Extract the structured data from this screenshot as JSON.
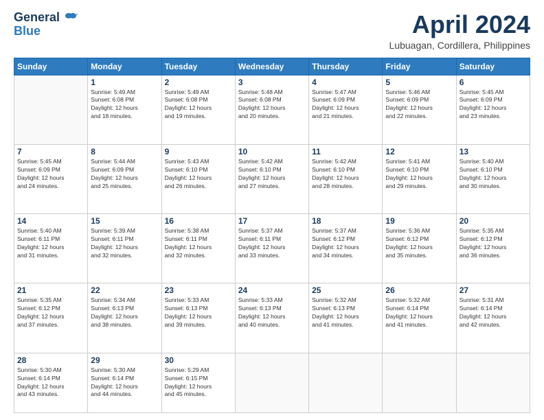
{
  "header": {
    "logo_line1": "General",
    "logo_line2": "Blue",
    "month": "April 2024",
    "location": "Lubuagan, Cordillera, Philippines"
  },
  "weekdays": [
    "Sunday",
    "Monday",
    "Tuesday",
    "Wednesday",
    "Thursday",
    "Friday",
    "Saturday"
  ],
  "weeks": [
    [
      {
        "day": "",
        "info": ""
      },
      {
        "day": "1",
        "info": "Sunrise: 5:49 AM\nSunset: 6:08 PM\nDaylight: 12 hours\nand 18 minutes."
      },
      {
        "day": "2",
        "info": "Sunrise: 5:49 AM\nSunset: 6:08 PM\nDaylight: 12 hours\nand 19 minutes."
      },
      {
        "day": "3",
        "info": "Sunrise: 5:48 AM\nSunset: 6:08 PM\nDaylight: 12 hours\nand 20 minutes."
      },
      {
        "day": "4",
        "info": "Sunrise: 5:47 AM\nSunset: 6:09 PM\nDaylight: 12 hours\nand 21 minutes."
      },
      {
        "day": "5",
        "info": "Sunrise: 5:46 AM\nSunset: 6:09 PM\nDaylight: 12 hours\nand 22 minutes."
      },
      {
        "day": "6",
        "info": "Sunrise: 5:45 AM\nSunset: 6:09 PM\nDaylight: 12 hours\nand 23 minutes."
      }
    ],
    [
      {
        "day": "7",
        "info": "Sunrise: 5:45 AM\nSunset: 6:09 PM\nDaylight: 12 hours\nand 24 minutes."
      },
      {
        "day": "8",
        "info": "Sunrise: 5:44 AM\nSunset: 6:09 PM\nDaylight: 12 hours\nand 25 minutes."
      },
      {
        "day": "9",
        "info": "Sunrise: 5:43 AM\nSunset: 6:10 PM\nDaylight: 12 hours\nand 26 minutes."
      },
      {
        "day": "10",
        "info": "Sunrise: 5:42 AM\nSunset: 6:10 PM\nDaylight: 12 hours\nand 27 minutes."
      },
      {
        "day": "11",
        "info": "Sunrise: 5:42 AM\nSunset: 6:10 PM\nDaylight: 12 hours\nand 28 minutes."
      },
      {
        "day": "12",
        "info": "Sunrise: 5:41 AM\nSunset: 6:10 PM\nDaylight: 12 hours\nand 29 minutes."
      },
      {
        "day": "13",
        "info": "Sunrise: 5:40 AM\nSunset: 6:10 PM\nDaylight: 12 hours\nand 30 minutes."
      }
    ],
    [
      {
        "day": "14",
        "info": "Sunrise: 5:40 AM\nSunset: 6:11 PM\nDaylight: 12 hours\nand 31 minutes."
      },
      {
        "day": "15",
        "info": "Sunrise: 5:39 AM\nSunset: 6:11 PM\nDaylight: 12 hours\nand 32 minutes."
      },
      {
        "day": "16",
        "info": "Sunrise: 5:38 AM\nSunset: 6:11 PM\nDaylight: 12 hours\nand 32 minutes."
      },
      {
        "day": "17",
        "info": "Sunrise: 5:37 AM\nSunset: 6:11 PM\nDaylight: 12 hours\nand 33 minutes."
      },
      {
        "day": "18",
        "info": "Sunrise: 5:37 AM\nSunset: 6:12 PM\nDaylight: 12 hours\nand 34 minutes."
      },
      {
        "day": "19",
        "info": "Sunrise: 5:36 AM\nSunset: 6:12 PM\nDaylight: 12 hours\nand 35 minutes."
      },
      {
        "day": "20",
        "info": "Sunrise: 5:35 AM\nSunset: 6:12 PM\nDaylight: 12 hours\nand 36 minutes."
      }
    ],
    [
      {
        "day": "21",
        "info": "Sunrise: 5:35 AM\nSunset: 6:12 PM\nDaylight: 12 hours\nand 37 minutes."
      },
      {
        "day": "22",
        "info": "Sunrise: 5:34 AM\nSunset: 6:13 PM\nDaylight: 12 hours\nand 38 minutes."
      },
      {
        "day": "23",
        "info": "Sunrise: 5:33 AM\nSunset: 6:13 PM\nDaylight: 12 hours\nand 39 minutes."
      },
      {
        "day": "24",
        "info": "Sunrise: 5:33 AM\nSunset: 6:13 PM\nDaylight: 12 hours\nand 40 minutes."
      },
      {
        "day": "25",
        "info": "Sunrise: 5:32 AM\nSunset: 6:13 PM\nDaylight: 12 hours\nand 41 minutes."
      },
      {
        "day": "26",
        "info": "Sunrise: 5:32 AM\nSunset: 6:14 PM\nDaylight: 12 hours\nand 41 minutes."
      },
      {
        "day": "27",
        "info": "Sunrise: 5:31 AM\nSunset: 6:14 PM\nDaylight: 12 hours\nand 42 minutes."
      }
    ],
    [
      {
        "day": "28",
        "info": "Sunrise: 5:30 AM\nSunset: 6:14 PM\nDaylight: 12 hours\nand 43 minutes."
      },
      {
        "day": "29",
        "info": "Sunrise: 5:30 AM\nSunset: 6:14 PM\nDaylight: 12 hours\nand 44 minutes."
      },
      {
        "day": "30",
        "info": "Sunrise: 5:29 AM\nSunset: 6:15 PM\nDaylight: 12 hours\nand 45 minutes."
      },
      {
        "day": "",
        "info": ""
      },
      {
        "day": "",
        "info": ""
      },
      {
        "day": "",
        "info": ""
      },
      {
        "day": "",
        "info": ""
      }
    ]
  ]
}
